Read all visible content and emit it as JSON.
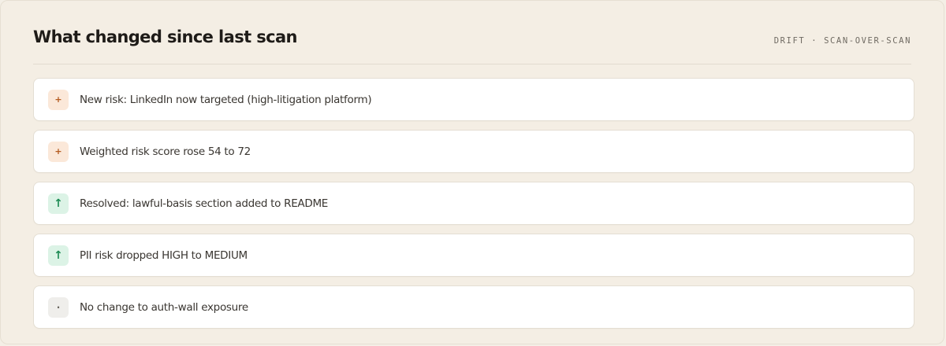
{
  "header": {
    "title": "What changed since last scan",
    "meta": "DRIFT · SCAN-OVER-SCAN"
  },
  "items": [
    {
      "glyph": "+",
      "kind": "worse",
      "text": "New risk: LinkedIn now targeted (high-litigation platform)"
    },
    {
      "glyph": "+",
      "kind": "worse",
      "text": "Weighted risk score rose 54 to 72"
    },
    {
      "glyph": "↑",
      "kind": "better",
      "text": "Resolved: lawful-basis section added to README"
    },
    {
      "glyph": "↑",
      "kind": "better",
      "text": "PII risk dropped HIGH to MEDIUM"
    },
    {
      "glyph": "·",
      "kind": "same",
      "text": "No change to auth-wall exposure"
    }
  ],
  "colors": {
    "worse_bg": "#fbe8d9",
    "worse_fg": "#b45a1f",
    "better_bg": "#dcf3e6",
    "better_fg": "#1c8a53",
    "same_bg": "#efeeeb",
    "same_fg": "#6b6760"
  }
}
